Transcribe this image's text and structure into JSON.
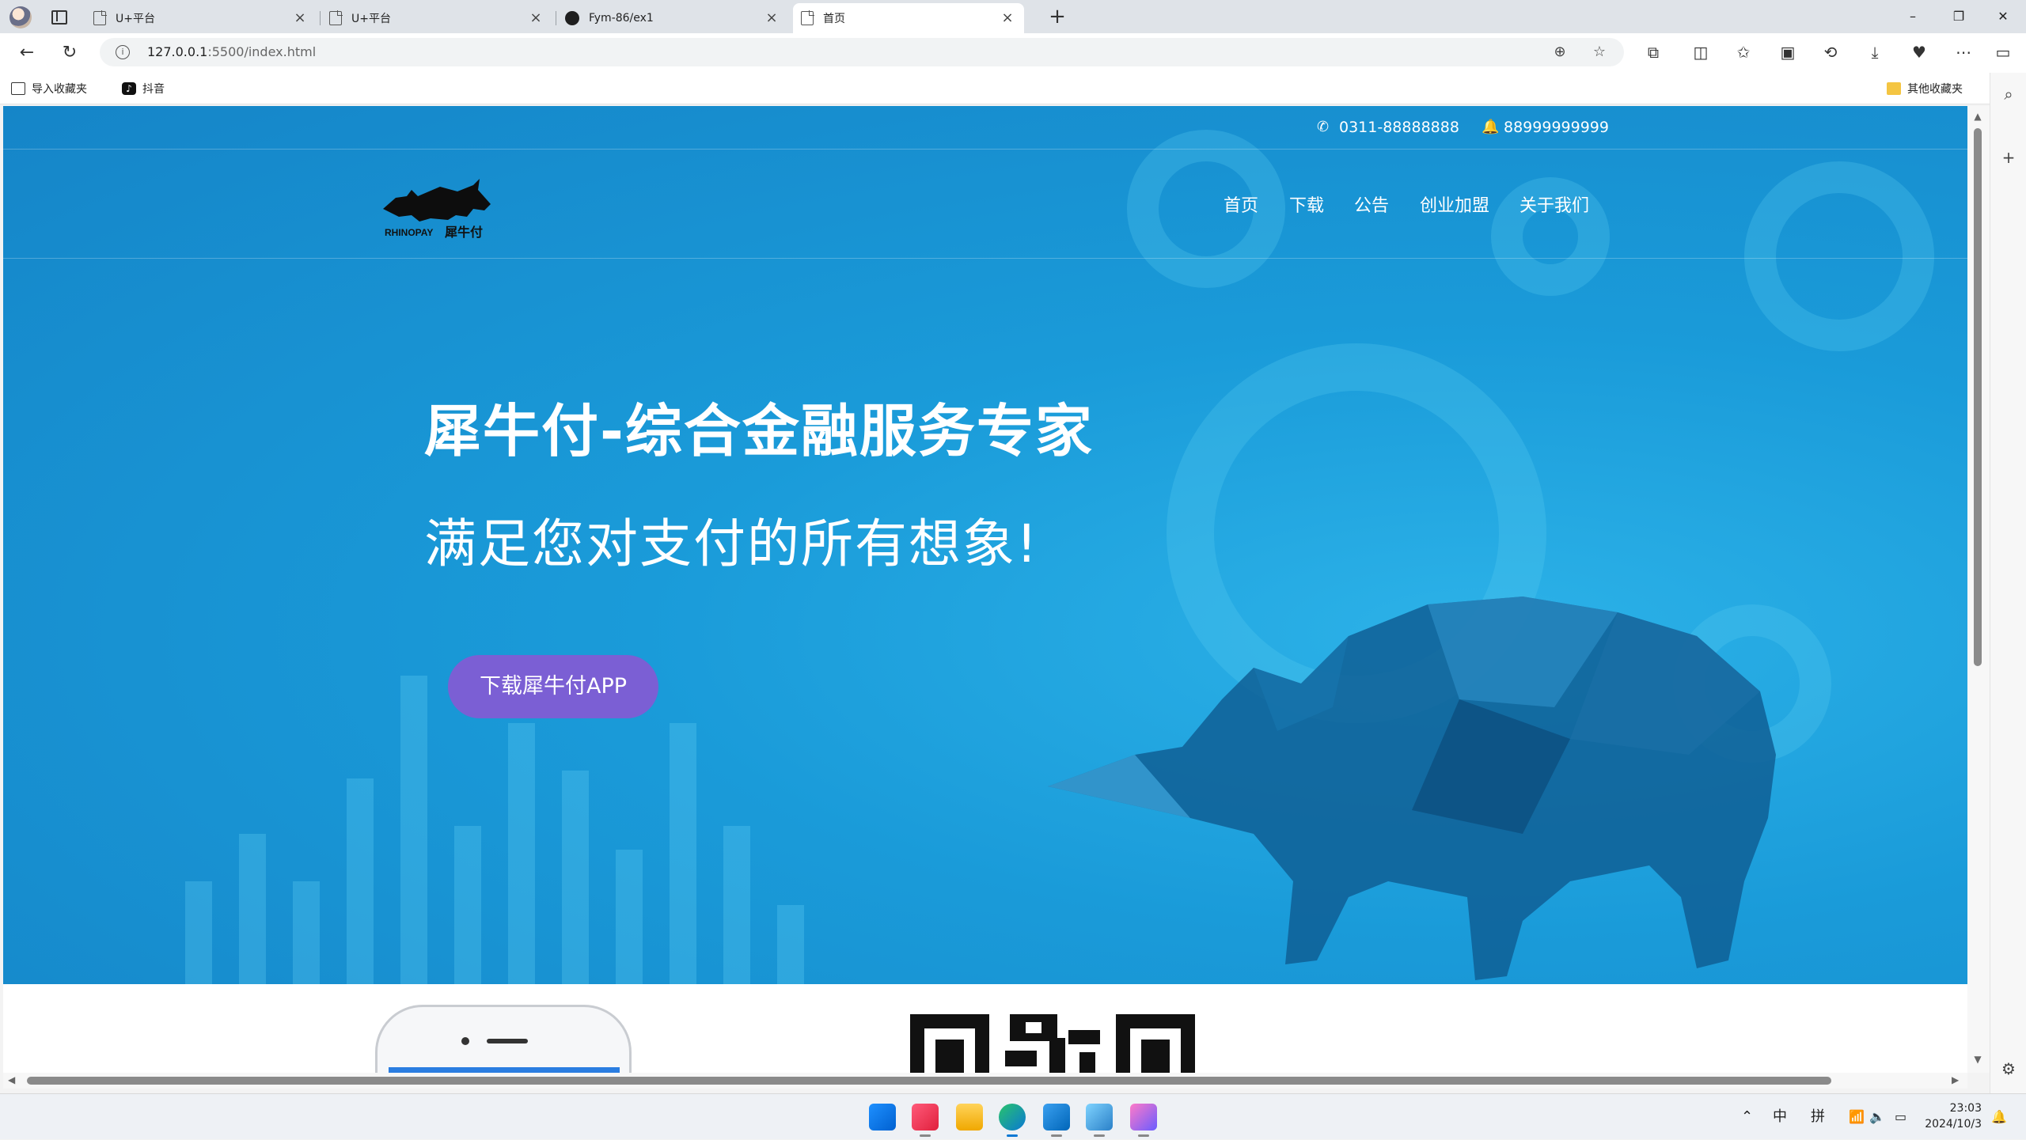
{
  "browser": {
    "tabs": [
      {
        "title": "U+平台",
        "icon": "page-icon"
      },
      {
        "title": "U+平台",
        "icon": "page-icon"
      },
      {
        "title": "Fym-86/ex1",
        "icon": "github-icon"
      },
      {
        "title": "首页",
        "icon": "page-icon",
        "active": true
      }
    ],
    "url_host": "127.0.0.1",
    "url_path": ":5500/index.html",
    "favorites": [
      {
        "label": "导入收藏夹",
        "icon": "import-icon"
      },
      {
        "label": "抖音",
        "icon": "tiktok-icon"
      }
    ],
    "other_favorites": "其他收藏夹"
  },
  "page": {
    "contact": {
      "phone": "0311-88888888",
      "qq": "88999999999"
    },
    "logo": {
      "brand_en": "RHINOPAY",
      "brand_cn": "犀牛付"
    },
    "nav": [
      "首页",
      "下载",
      "公告",
      "创业加盟",
      "关于我们"
    ],
    "hero": {
      "headline": "犀牛付-综合金融服务专家",
      "subline": "满足您对支付的所有想象!",
      "button": "下载犀牛付APP"
    },
    "colors": {
      "hero_blue": "#1a9bd9",
      "button_purple": "#7b5fd4"
    }
  },
  "taskbar": {
    "apps": [
      "windows-start-icon",
      "music-app-icon",
      "file-explorer-icon",
      "edge-browser-icon",
      "vscode-icon",
      "tool-app-icon",
      "ai-app-icon"
    ],
    "ime_lang": "中",
    "ime_mode": "拼",
    "time": "23:03",
    "date": "2024/10/3"
  }
}
